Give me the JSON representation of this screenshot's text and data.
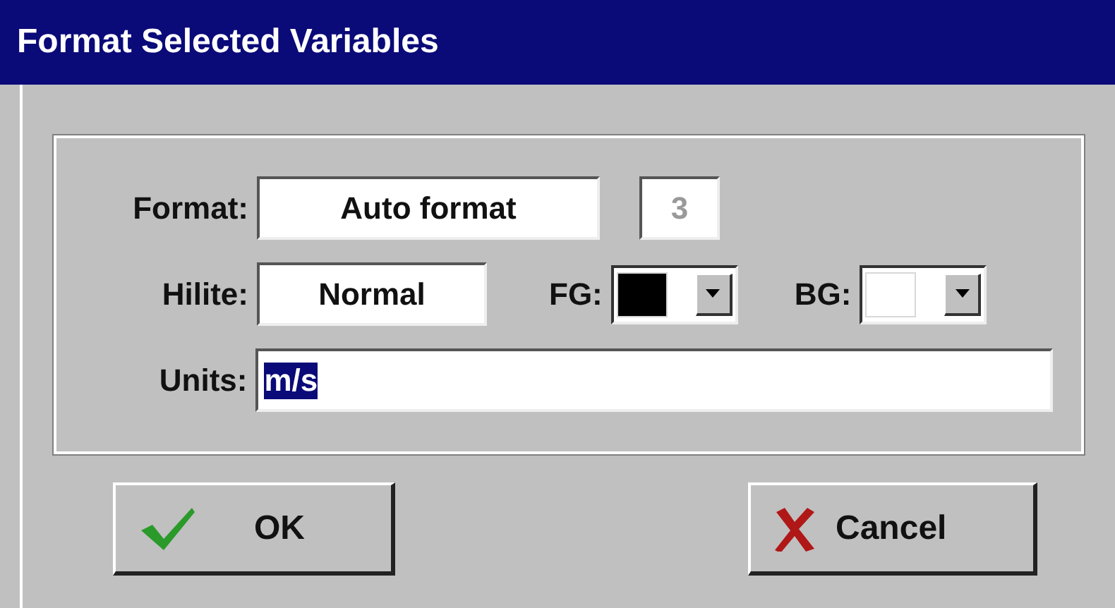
{
  "window": {
    "title": "Format Selected Variables"
  },
  "format": {
    "label": "Format:",
    "value": "Auto format",
    "digits": {
      "value": "3",
      "disabled": true
    }
  },
  "hilite": {
    "label": "Hilite:",
    "value": "Normal"
  },
  "fg": {
    "label": "FG:",
    "color": "#000000"
  },
  "bg": {
    "label": "BG:",
    "color": "#ffffff"
  },
  "units": {
    "label": "Units:",
    "value": "m/s",
    "selected": true
  },
  "buttons": [
    {
      "kind": "ok",
      "label": "OK"
    },
    {
      "kind": "cancel",
      "label": "Cancel"
    }
  ]
}
